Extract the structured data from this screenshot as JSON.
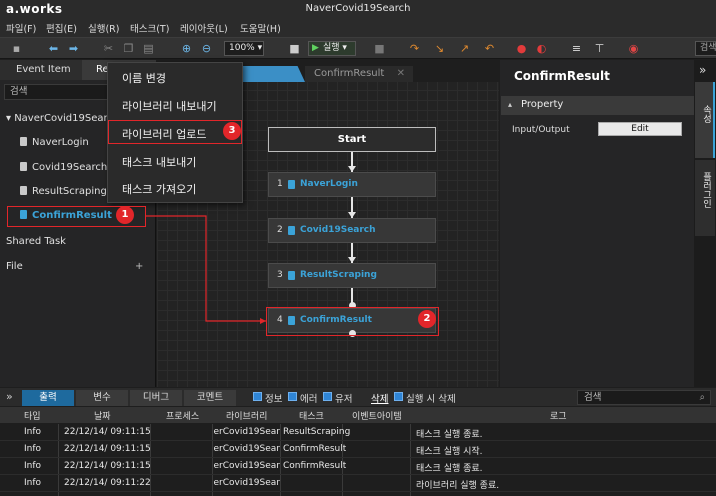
{
  "app": {
    "logo": "a.works",
    "window_title": "NaverCovid19Search"
  },
  "menubar": [
    "파일(F)",
    "편집(E)",
    "실행(R)",
    "태스크(T)",
    "레이아웃(L)",
    "도움말(H)"
  ],
  "toolbar": {
    "zoom": "100%",
    "run_label": "실행",
    "search_label": "검색"
  },
  "left_panel": {
    "tabs": [
      "Event Item",
      "Re"
    ],
    "search_placeholder": "검색",
    "tree_root": "NaverCovid19Search",
    "tasks": [
      "NaverLogin",
      "Covid19Search",
      "ResultScraping",
      "ConfirmResult"
    ],
    "shared_task": "Shared Task",
    "file": "File",
    "file_add": "+"
  },
  "context_menu": [
    "이름 변경",
    "라이브러리 내보내기",
    "라이브러리 업로드",
    "태스크 내보내기",
    "태스크 가져오기"
  ],
  "doc_tabs": {
    "inactive": "ConfirmResult",
    "close": "✕"
  },
  "flow": {
    "start": "Start",
    "nodes": [
      {
        "num": "1",
        "label": "NaverLogin"
      },
      {
        "num": "2",
        "label": "Covid19Search"
      },
      {
        "num": "3",
        "label": "ResultScraping"
      },
      {
        "num": "4",
        "label": "ConfirmResult"
      }
    ]
  },
  "badges": [
    "1",
    "2",
    "3"
  ],
  "right_panel": {
    "title": "ConfirmResult",
    "section": "Property",
    "io_label": "Input/Output",
    "edit_button": "Edit",
    "side_tabs": [
      "속성",
      "플러그인"
    ],
    "expand": "»"
  },
  "bottom": {
    "collapse": "»",
    "tabs": [
      "출력",
      "변수",
      "디버그",
      "코멘트"
    ],
    "filters": [
      "정보",
      "에러",
      "유저"
    ],
    "delete_label": "삭제",
    "delete_on_run": "실행 시 삭제",
    "search_placeholder": "검색",
    "columns": [
      "타입",
      "날짜",
      "프로세스",
      "라이브러리",
      "태스크",
      "이벤트아이템",
      "로그"
    ],
    "rows": [
      [
        "Info",
        "22/12/14/ 09:11:15",
        "",
        "NaverCovid19Sear",
        "ResultScraping",
        "",
        "태스크 실행 종료."
      ],
      [
        "Info",
        "22/12/14/ 09:11:15",
        "",
        "NaverCovid19Sear",
        "ConfirmResult",
        "",
        "태스크 실행 시작."
      ],
      [
        "Info",
        "22/12/14/ 09:11:15",
        "",
        "NaverCovid19Sear",
        "ConfirmResult",
        "",
        "태스크 실행 종료."
      ],
      [
        "Info",
        "22/12/14/ 09:11:22",
        "",
        "NaverCovid19Sear",
        "",
        "",
        "라이브러리 실행 종료."
      ]
    ]
  },
  "colors": {
    "accent": "#3ba3d8",
    "highlight": "#e2262a",
    "background": "#1e1e1e"
  }
}
